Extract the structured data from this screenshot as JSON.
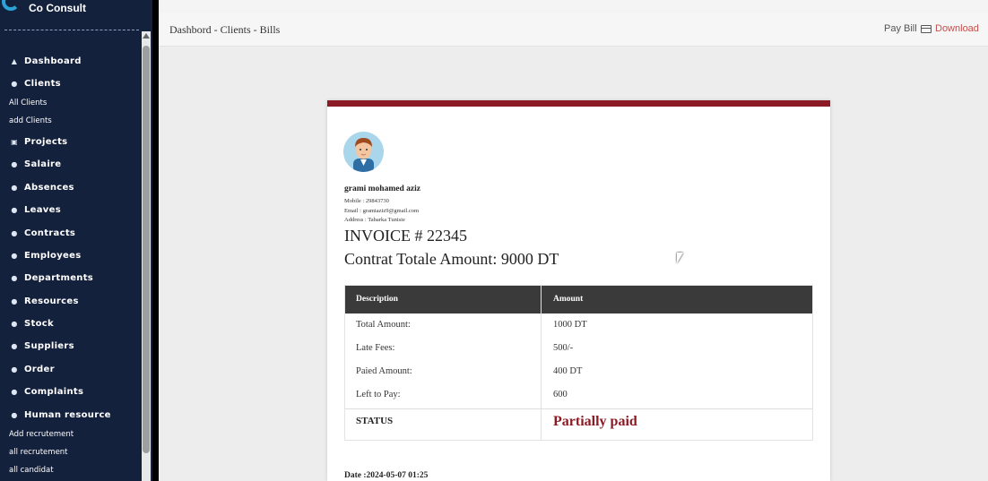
{
  "brand": {
    "name": "Co Consult"
  },
  "sidebar": {
    "items": [
      {
        "label": "Dashboard",
        "icon": "home-icon"
      },
      {
        "label": "Clients",
        "icon": "user-icon"
      },
      {
        "label": "Projects",
        "icon": "folder-icon"
      },
      {
        "label": "Salaire",
        "icon": "user-icon"
      },
      {
        "label": "Absences",
        "icon": "user-icon"
      },
      {
        "label": "Leaves",
        "icon": "user-icon"
      },
      {
        "label": "Contracts",
        "icon": "user-icon"
      },
      {
        "label": "Employees",
        "icon": "user-icon"
      },
      {
        "label": "Departments",
        "icon": "user-icon"
      },
      {
        "label": "Resources",
        "icon": "user-icon"
      },
      {
        "label": "Stock",
        "icon": "user-icon"
      },
      {
        "label": "Suppliers",
        "icon": "user-icon"
      },
      {
        "label": "Order",
        "icon": "user-icon"
      },
      {
        "label": "Complaints",
        "icon": "user-icon"
      },
      {
        "label": "Human resource",
        "icon": "user-icon"
      }
    ],
    "clients_sub": [
      "All Clients",
      "add Clients"
    ],
    "hr_sub": [
      "Add recrutement",
      "all recrutement",
      "all candidat"
    ]
  },
  "header": {
    "breadcrumb": "Dashbord - Clients - Bills",
    "pay_bill": "Pay Bill",
    "download": "Download"
  },
  "invoice": {
    "client_name": "grami mohamed aziz",
    "mobile": "Mobile : 29843730",
    "email": "Email : gramiaziz9@gmail.com",
    "address": "Address : Tabarka Tunisie",
    "invoice_no": "INVOICE # 22345",
    "contract_total": "Contrat Totale Amount: 9000 DT",
    "table": {
      "headers": [
        "Description",
        "Amount"
      ],
      "rows": [
        [
          "Total Amount:",
          "1000 DT"
        ],
        [
          "Late Fees:",
          "500/-"
        ],
        [
          "Paied Amount:",
          "400 DT"
        ],
        [
          "Left to Pay:",
          "600"
        ]
      ],
      "status_label": "STATUS",
      "status_value": "Partially paid"
    },
    "date": "Date :2024-05-07 01:25"
  },
  "colors": {
    "sidebar_bg": "#14213d",
    "accent": "#8b1a24",
    "table_header": "#3a3a3a"
  }
}
